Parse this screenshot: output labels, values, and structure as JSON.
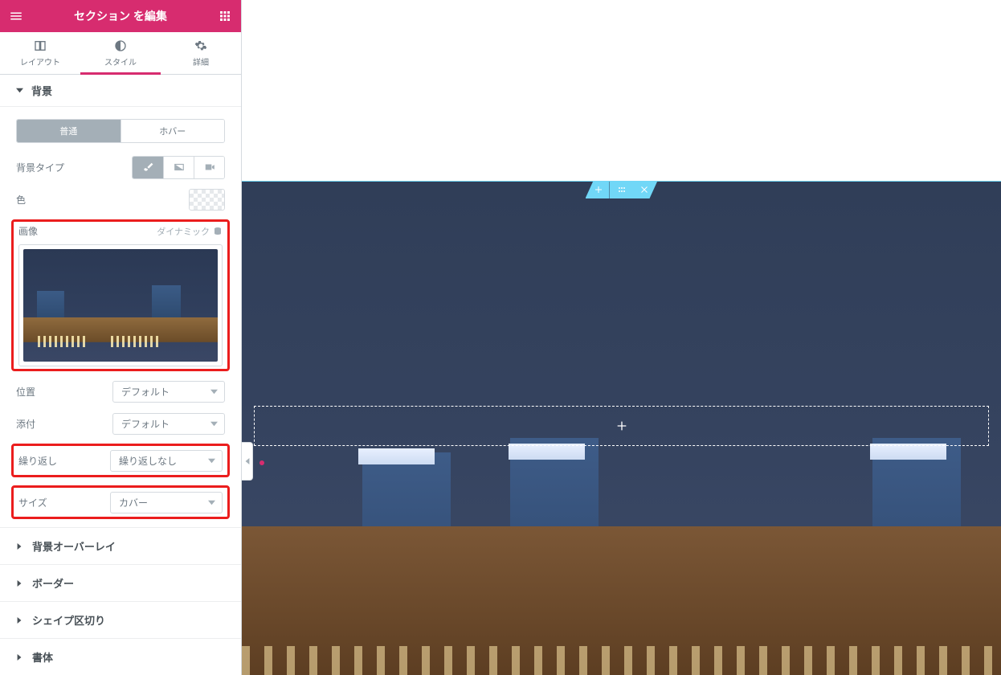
{
  "header": {
    "title": "セクション を編集"
  },
  "tabs": {
    "layout": "レイアウト",
    "style": "スタイル",
    "advanced": "詳細",
    "active": "style"
  },
  "section_background": {
    "title": "背景",
    "state_toggle": {
      "normal": "普通",
      "hover": "ホバー"
    },
    "bg_type_label": "背景タイプ",
    "color_label": "色",
    "image": {
      "label": "画像",
      "dynamic_label": "ダイナミック"
    },
    "position": {
      "label": "位置",
      "value": "デフォルト"
    },
    "attachment": {
      "label": "添付",
      "value": "デフォルト"
    },
    "repeat": {
      "label": "繰り返し",
      "value": "繰り返しなし"
    },
    "size": {
      "label": "サイズ",
      "value": "カバー"
    }
  },
  "collapsed_sections": [
    "背景オーバーレイ",
    "ボーダー",
    "シェイプ区切り",
    "書体"
  ],
  "icons": {
    "menu": "menu-icon",
    "grid": "grid-icon",
    "layout": "columns-icon",
    "style": "contrast-icon",
    "advanced": "gear-icon",
    "brush": "brush-icon",
    "gradient": "gradient-icon",
    "video": "video-icon",
    "database": "database-icon",
    "plus": "plus-icon",
    "drag": "drag-icon",
    "close": "close-icon",
    "caret_down": "caret-down-icon",
    "caret_right": "caret-right-icon",
    "caret_left": "caret-left-icon"
  }
}
